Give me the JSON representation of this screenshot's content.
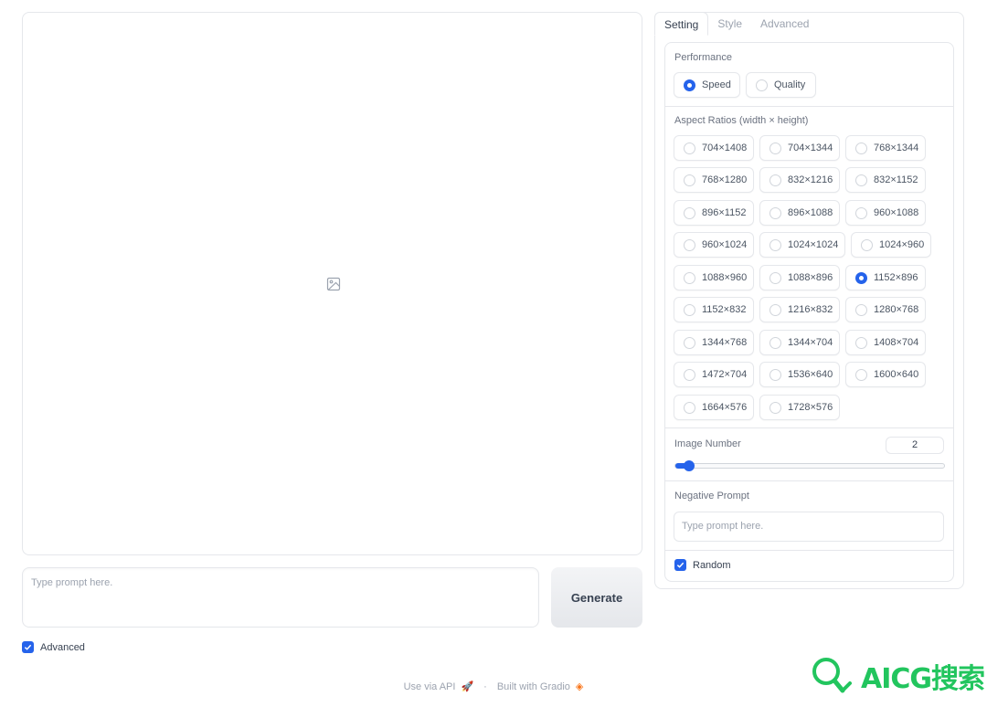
{
  "prompt": {
    "placeholder": "Type prompt here."
  },
  "generate_label": "Generate",
  "advanced_label": "Advanced",
  "footer": {
    "api": "Use via API",
    "separator": "·",
    "built": "Built with Gradio"
  },
  "tabs": [
    "Setting",
    "Style",
    "Advanced"
  ],
  "performance": {
    "label": "Performance",
    "options": [
      "Speed",
      "Quality"
    ],
    "selected": "Speed"
  },
  "aspect": {
    "label": "Aspect Ratios (width × height)",
    "options": [
      "704×1408",
      "704×1344",
      "768×1344",
      "768×1280",
      "832×1216",
      "832×1152",
      "896×1152",
      "896×1088",
      "960×1088",
      "960×1024",
      "1024×1024",
      "1024×960",
      "1088×960",
      "1088×896",
      "1152×896",
      "1152×832",
      "1216×832",
      "1280×768",
      "1344×768",
      "1344×704",
      "1408×704",
      "1472×704",
      "1536×640",
      "1600×640",
      "1664×576",
      "1728×576"
    ],
    "selected": "1152×896"
  },
  "image_number": {
    "label": "Image Number",
    "value": "2",
    "min": 1,
    "max": 32
  },
  "negative": {
    "label": "Negative Prompt",
    "placeholder": "Type prompt here."
  },
  "random_label": "Random",
  "watermark": "AICG搜索",
  "colors": {
    "accent": "#2563eb",
    "watermark": "#22c55e"
  }
}
